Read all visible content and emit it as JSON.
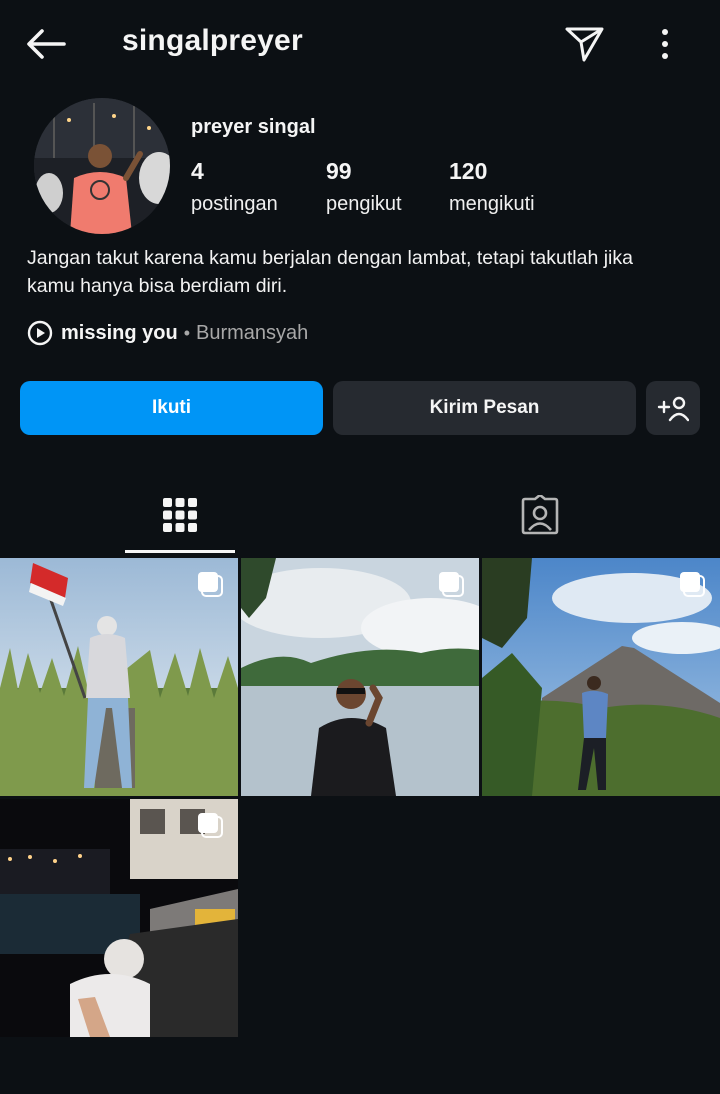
{
  "header": {
    "username": "singalpreyer",
    "icons": [
      "back-arrow-icon",
      "send-icon",
      "more-vertical-icon"
    ]
  },
  "profile": {
    "display_name": "preyer singal",
    "stats": [
      {
        "value": "4",
        "label": "postingan"
      },
      {
        "value": "99",
        "label": "pengikut"
      },
      {
        "value": "120",
        "label": "mengikuti"
      }
    ],
    "bio_line1": "Jangan takut karena kamu berjalan dengan lambat, tetapi takutlah jika",
    "bio_line2": "kamu hanya bisa berdiam diri.",
    "music": {
      "song": "missing you",
      "separator": "•",
      "artist": "Burmansyah"
    }
  },
  "actions": {
    "follow_label": "Ikuti",
    "message_label": "Kirim Pesan"
  },
  "tabs": [
    "grid-icon",
    "tagged-icon"
  ],
  "posts": [
    {
      "type": "carousel"
    },
    {
      "type": "carousel"
    },
    {
      "type": "carousel"
    },
    {
      "type": "carousel"
    }
  ],
  "colors": {
    "background": "#0c1014",
    "accent": "#0095f6",
    "secondary_button": "#262a30",
    "muted_text": "#a8a8a8"
  }
}
